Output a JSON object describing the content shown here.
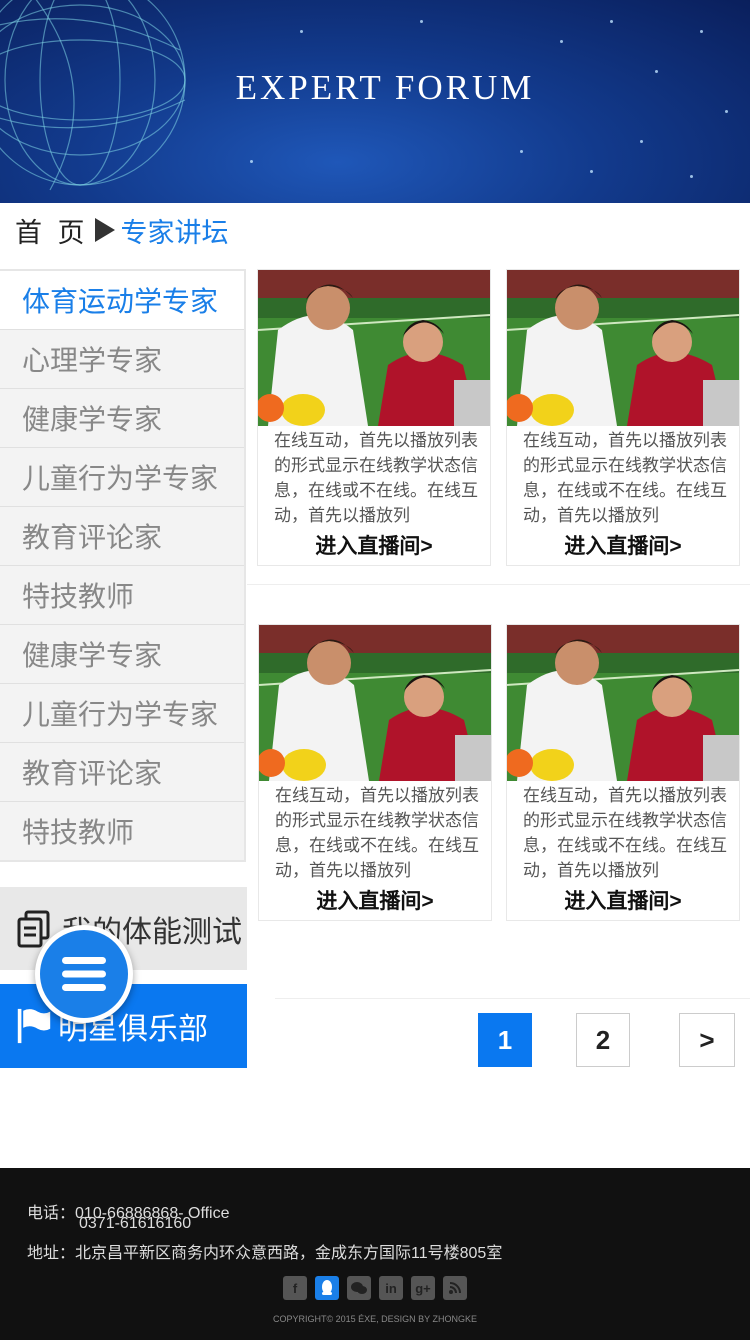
{
  "banner": {
    "title": "EXPERT FORUM"
  },
  "breadcrumb": {
    "home": "首 页",
    "current": "专家讲坛"
  },
  "sidebar": {
    "items": [
      {
        "label": "体育运动学专家"
      },
      {
        "label": "心理学专家"
      },
      {
        "label": "健康学专家"
      },
      {
        "label": "儿童行为学专家"
      },
      {
        "label": "教育评论家"
      },
      {
        "label": "特技教师"
      },
      {
        "label": "健康学专家"
      },
      {
        "label": "儿童行为学专家"
      },
      {
        "label": "教育评论家"
      },
      {
        "label": "特技教师"
      }
    ],
    "fitness_test": "我的体能测试",
    "star_club": "明星俱乐部"
  },
  "cards": [
    {
      "text": "在线互动，首先以播放列表的形式显示在线教学状态信息，在线或不在线。在线互动，首先以播放列",
      "link": "进入直播间>"
    },
    {
      "text": "在线互动，首先以播放列表的形式显示在线教学状态信息，在线或不在线。在线互动，首先以播放列",
      "link": "进入直播间>"
    },
    {
      "text": "在线互动，首先以播放列表的形式显示在线教学状态信息，在线或不在线。在线互动，首先以播放列",
      "link": "进入直播间>"
    },
    {
      "text": "在线互动，首先以播放列表的形式显示在线教学状态信息，在线或不在线。在线互动，首先以播放列",
      "link": "进入直播间>"
    }
  ],
  "pagination": {
    "pages": [
      "1",
      "2"
    ],
    "next": ">",
    "current": "1"
  },
  "footer": {
    "phone_label": "电话：",
    "phone_1": "010-66886868- Office",
    "phone_2": "0371-61616160",
    "address_label": "地址：",
    "address": "北京昌平新区商务内环众意西路，金成东方国际11号楼805室",
    "social": [
      "facebook-icon",
      "qq-icon",
      "wechat-icon",
      "linkedin-icon",
      "google-plus-icon",
      "rss-icon"
    ],
    "copyright": "COPYRIGHT© 2015 ÉXE, DESIGN BY ZHONGKE"
  },
  "colors": {
    "accent": "#1a7fe8",
    "button_blue": "#0a78f0",
    "footer_bg": "#111111"
  }
}
